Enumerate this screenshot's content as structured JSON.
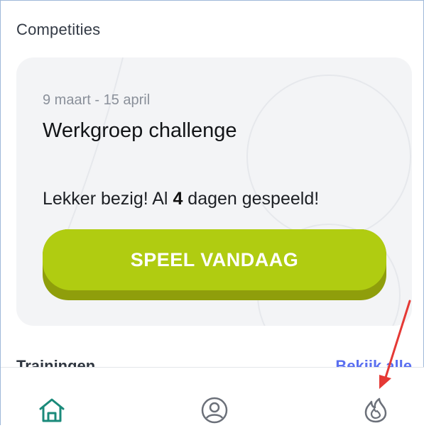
{
  "section": {
    "title": "Competities"
  },
  "competition_card": {
    "date_range": "9 maart - 15 april",
    "title": "Werkgroep challenge",
    "message_prefix": "Lekker bezig! Al ",
    "days_count": "4",
    "message_suffix": " dagen gespeeld!",
    "play_button_label": "SPEEL VANDAAG",
    "button_color": "#b0cc11"
  },
  "next_section": {
    "title": "Trainingen",
    "link": "Bekijk alle"
  },
  "bottom_nav": {
    "items": [
      {
        "icon": "home-icon",
        "active": true,
        "color": "#1a8a7a"
      },
      {
        "icon": "profile-icon",
        "active": false
      },
      {
        "icon": "flame-icon",
        "active": false
      }
    ]
  },
  "annotation": {
    "type": "arrow",
    "color": "#e53935",
    "points_to": "flame-icon"
  }
}
